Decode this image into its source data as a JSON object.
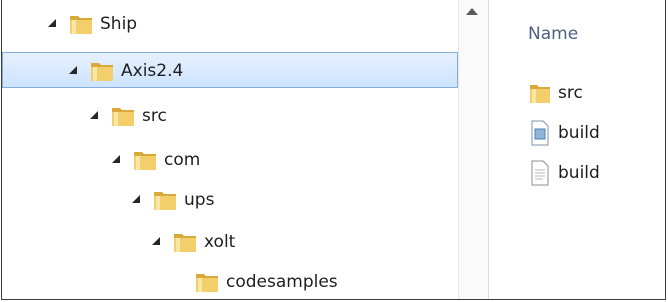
{
  "tree": {
    "items": [
      {
        "label": "Ship",
        "expanded": true,
        "selected": false
      },
      {
        "label": "Axis2.4",
        "expanded": true,
        "selected": true
      },
      {
        "label": "src",
        "expanded": true,
        "selected": false
      },
      {
        "label": "com",
        "expanded": true,
        "selected": false
      },
      {
        "label": "ups",
        "expanded": true,
        "selected": false
      },
      {
        "label": "xolt",
        "expanded": true,
        "selected": false
      },
      {
        "label": "codesamples",
        "expanded": false,
        "selected": false
      }
    ]
  },
  "list": {
    "column_header": "Name",
    "items": [
      {
        "label": "src",
        "icon": "folder-icon"
      },
      {
        "label": "build",
        "icon": "config-file-icon"
      },
      {
        "label": "build",
        "icon": "text-file-icon"
      }
    ]
  },
  "colors": {
    "selection": "#cde3ff",
    "selection_border": "#84acdd",
    "header_text": "#4d6185"
  }
}
